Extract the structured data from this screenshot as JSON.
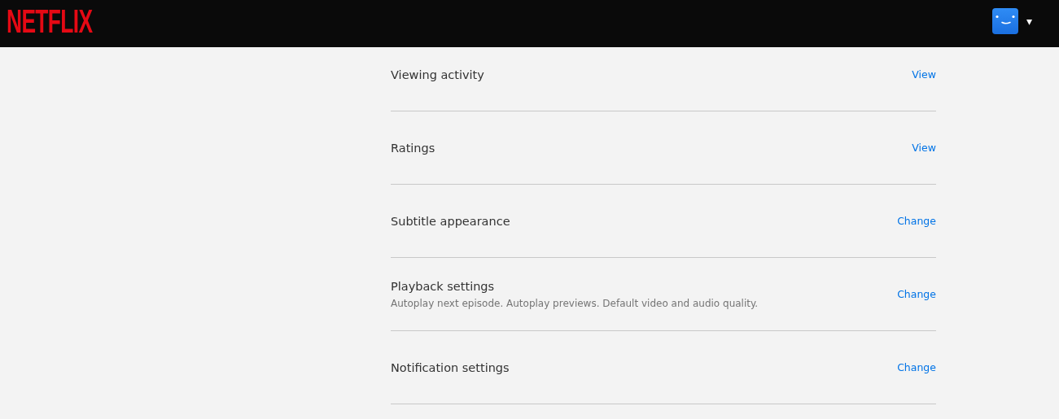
{
  "header": {
    "logo": "NETFLIX",
    "profile_menu": {
      "caret": "▾"
    }
  },
  "settings": [
    {
      "label": "Viewing activity",
      "action": "View"
    },
    {
      "label": "Ratings",
      "action": "View"
    },
    {
      "label": "Subtitle appearance",
      "action": "Change"
    },
    {
      "label": "Playback settings",
      "description": "Autoplay next episode. Autoplay previews. Default video and audio quality.",
      "action": "Change"
    },
    {
      "label": "Notification settings",
      "action": "Change"
    }
  ]
}
